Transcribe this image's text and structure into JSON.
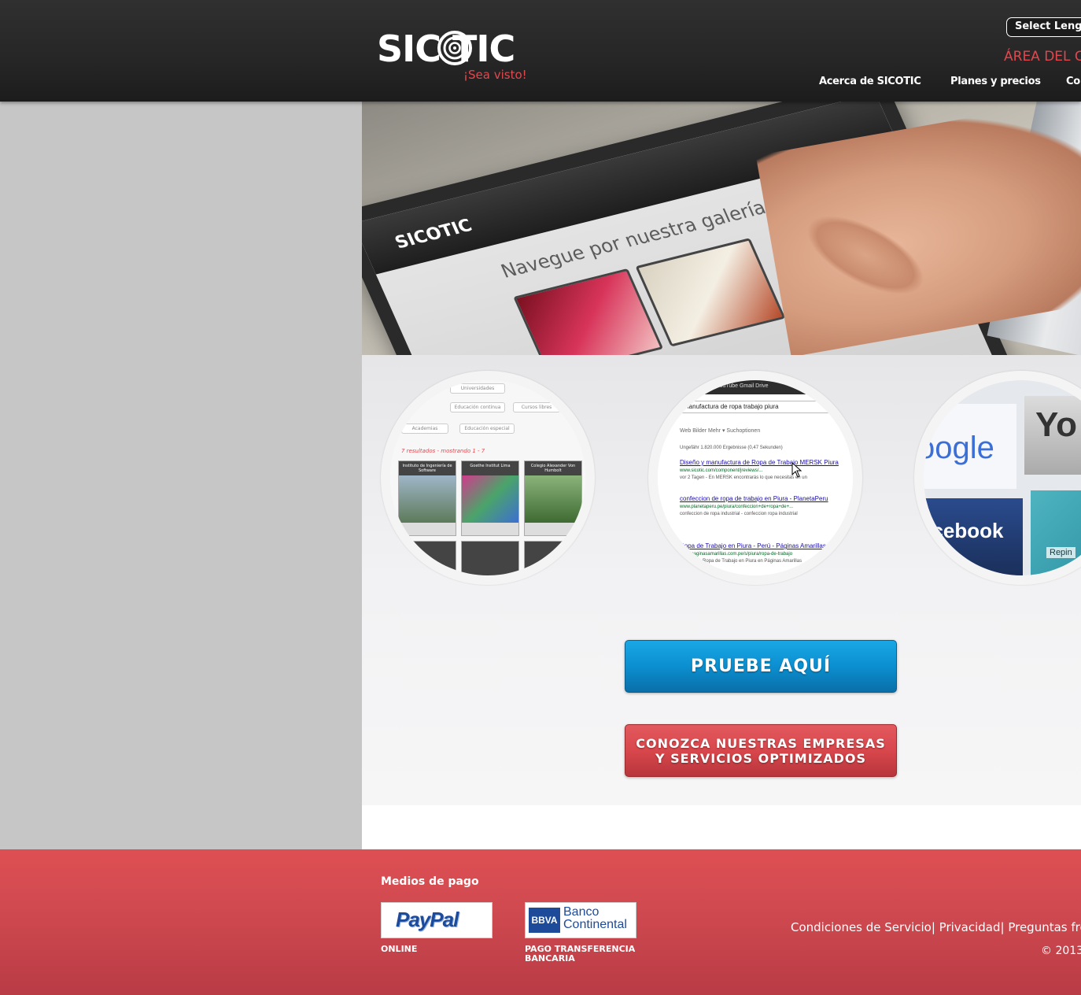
{
  "header": {
    "logo_text": "SIC TIC",
    "tagline": "¡Sea visto!",
    "language_select": "Select Lengu",
    "client_area": "ÁREA DEL C",
    "nav": [
      {
        "label": "Acerca de SICOTIC"
      },
      {
        "label": "Planes y precios"
      },
      {
        "label": "Co"
      }
    ]
  },
  "hero": {
    "tablet_logo": "SICOTIC",
    "tablet_heading": "Navegue por nuestra galería de empresas"
  },
  "circles": {
    "directory": {
      "pills": [
        "Universidades",
        "Educación continua",
        "Cursos libres",
        "Academias",
        "Educación especial"
      ],
      "results": "7 resultados - mostrando 1 - 7",
      "cards": [
        "Instituto de Ingeniería de Software",
        "Goethe Institut Lima",
        "Colegio Alexander Von Humbolt"
      ]
    },
    "search": {
      "bar": "Maps   Play   YouTube   Gmail   Drive",
      "query": "manufactura de ropa trabajo piura",
      "tabs": "Web      Bilder      Mehr ▾      Suchoptionen",
      "count": "Ungefähr 1.820.000 Ergebnisse (0,47 Sekunden)",
      "results": [
        {
          "title": "Diseño y manufactura de Ropa de Trabajo MERSK Piura",
          "url": "www.sicotic.com/component/jreviews/...",
          "desc": "vor 2 Tagen - En MERSK encontrarás lo que necesitas en un"
        },
        {
          "title": "confeccion de ropa de trabajo en Piura - PlanetaPeru",
          "url": "www.planetaperu.pe/piura/confeccion+de+ropa+de+...",
          "desc": "confeccion de ropa industrial - confeccion ropa industrial"
        },
        {
          "title": "Ropa de Trabajo en Piura - Perú - Páginas Amarillas",
          "url": "www.paginasamarillas.com.pe/s/piura/ropa-de-trabajo",
          "desc": "Encuentra Ropa de Trabajo en Piura en Páginas Amarillas"
        }
      ]
    },
    "social": {
      "google": "oogle",
      "facebook": "acebook",
      "youtube": "Yo",
      "repin": "Repin"
    }
  },
  "buttons": {
    "try": "PRUEBE AQUÍ",
    "companies_line1": "CONOZCA NUESTRAS EMPRESAS",
    "companies_line2": "Y SERVICIOS OPTIMIZADOS"
  },
  "footer": {
    "title": "Medios de pago",
    "paypal": "PayPal",
    "paypal_label": "ONLINE",
    "bbva_mark": "BBVA",
    "bbva_line1": "Banco",
    "bbva_line2": "Continental",
    "bbva_label_line1": "PAGO TRANSFERENCIA",
    "bbva_label_line2": "BANCARIA",
    "links": [
      "Condiciones de Servicio",
      "Privacidad",
      "Preguntas fre"
    ],
    "copyright": "© 2013"
  },
  "colors": {
    "brand_red": "#e0484e",
    "button_blue": "#0b8fd0",
    "header_dark": "#262626"
  }
}
